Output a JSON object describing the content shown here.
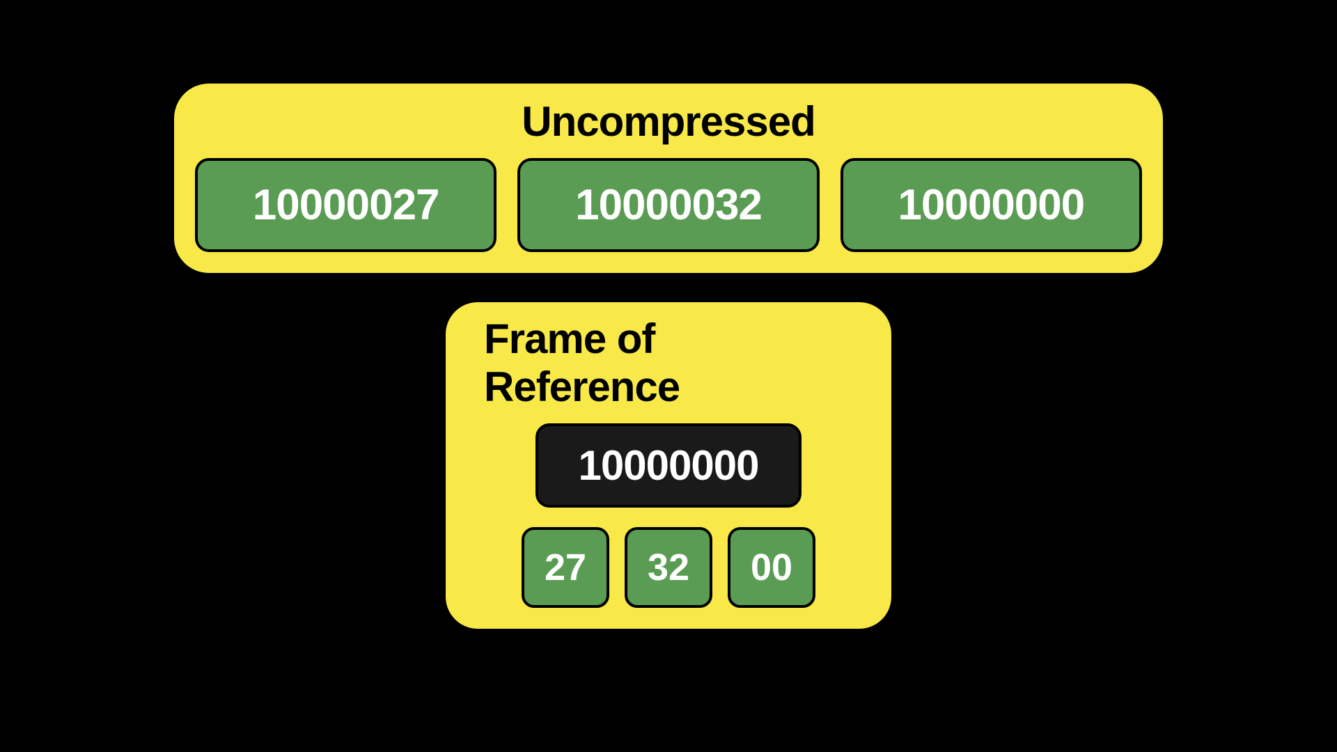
{
  "uncompressed": {
    "title": "Uncompressed",
    "values": [
      "10000027",
      "10000032",
      "10000000"
    ]
  },
  "frame_of_reference": {
    "title": "Frame of Reference",
    "base": "10000000",
    "deltas": [
      "27",
      "32",
      "00"
    ]
  }
}
